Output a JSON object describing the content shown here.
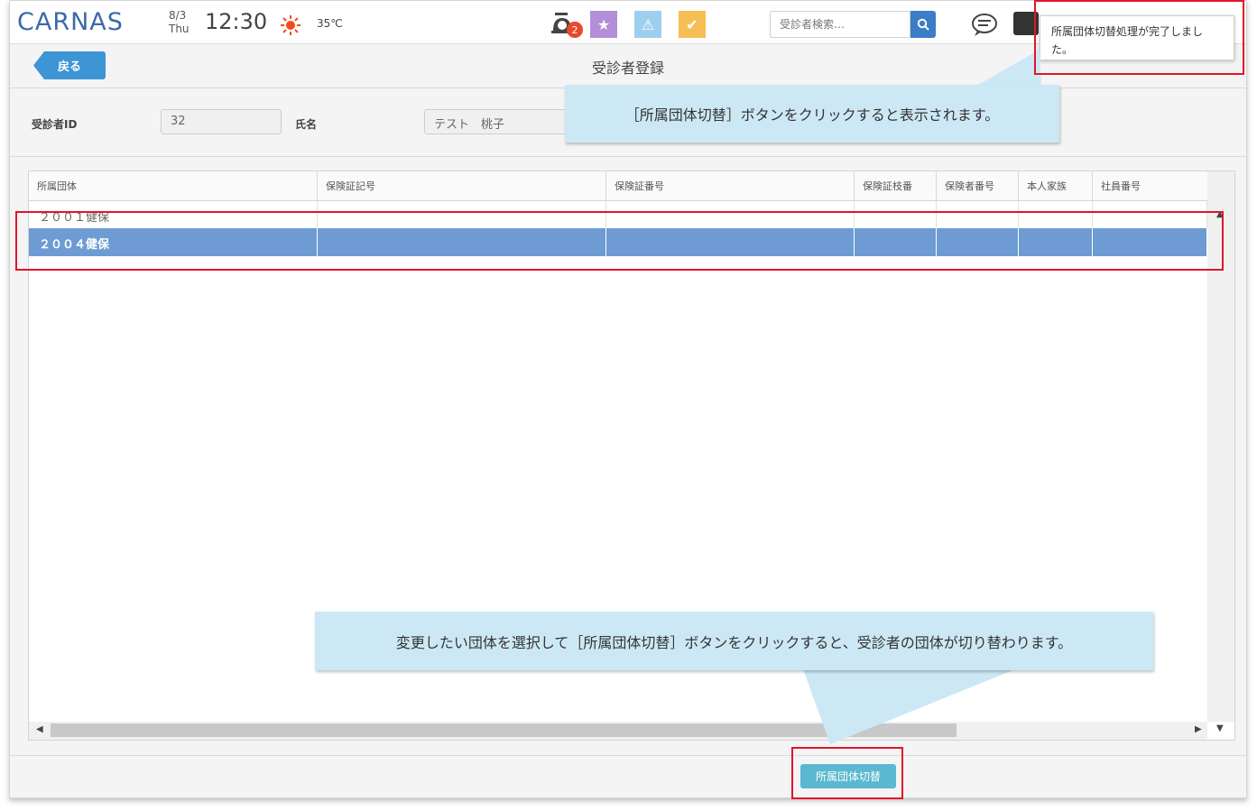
{
  "header": {
    "logo": "CARNAS",
    "date": "8/3",
    "weekday": "Thu",
    "time": "12:30",
    "temperature": "35℃",
    "notification_count": "2",
    "search_placeholder": "受診者検索…",
    "icons": [
      "clock-bell-icon",
      "star-icon",
      "warning-icon",
      "certificate-icon",
      "search-icon",
      "chat-icon",
      "user-card-icon"
    ]
  },
  "toolbar": {
    "back_label": "戻る",
    "page_title": "受診者登録"
  },
  "patient": {
    "id_label": "受診者ID",
    "id_value": "32",
    "name_label": "氏名",
    "name_value": "テスト　桃子"
  },
  "table": {
    "columns": [
      "所属団体",
      "保険証記号",
      "保険証番号",
      "保険証枝番",
      "保険者番号",
      "本人家族",
      "社員番号"
    ],
    "rows": [
      {
        "group": "２００１健保",
        "selected": false
      },
      {
        "group": "２００４健保",
        "selected": true
      }
    ]
  },
  "actions": {
    "switch_label": "所属団体切替"
  },
  "toast": {
    "message": "所属団体切替処理が完了しました。"
  },
  "callouts": {
    "top": "［所属団体切替］ボタンをクリックすると表示されます。",
    "bottom": "変更したい団体を選択して［所属団体切替］ボタンをクリックすると、受診者の団体が切り替わります。"
  },
  "colors": {
    "accent": "#3e95d6",
    "selected_row": "#6e9bd3",
    "switch_button": "#5ab8d0",
    "highlight": "#e0162b",
    "callout_bg": "#cde8f5"
  }
}
